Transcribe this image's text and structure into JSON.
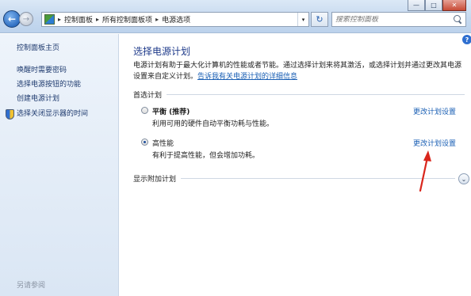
{
  "window": {
    "minimize_glyph": "—",
    "maximize_glyph": "□",
    "close_glyph": "✕"
  },
  "navigation": {
    "back_glyph": "←",
    "forward_glyph": "→",
    "dropdown_glyph": "▾",
    "breadcrumbs": [
      "控制面板",
      "所有控制面板项",
      "电源选项"
    ],
    "separator_glyph": "▸",
    "refresh_glyph": "↻",
    "search_placeholder": "搜索控制面板"
  },
  "sidebar": {
    "home_label": "控制面板主页",
    "items": [
      {
        "label": "唤醒时需要密码",
        "icon": ""
      },
      {
        "label": "选择电源按钮的功能",
        "icon": ""
      },
      {
        "label": "创建电源计划",
        "icon": ""
      },
      {
        "label": "选择关闭显示器的时间",
        "icon": "shield-icon"
      }
    ],
    "footer_label": "另请参阅"
  },
  "main": {
    "help_glyph": "?",
    "title": "选择电源计划",
    "intro_text": "电源计划有助于最大化计算机的性能或者节能。通过选择计划来将其激活，或选择计划并通过更改其电源设置来自定义计划。",
    "intro_link": "告诉我有关电源计划的详细信息",
    "preferred_section_label": "首选计划",
    "plans": [
      {
        "name": "平衡 (推荐)",
        "description": "利用可用的硬件自动平衡功耗与性能。",
        "selected": false,
        "change_link": "更改计划设置"
      },
      {
        "name": "高性能",
        "description": "有利于提高性能，但会增加功耗。",
        "selected": true,
        "change_link": "更改计划设置"
      }
    ],
    "additional_section_label": "显示附加计划",
    "expand_glyph": "⌄"
  },
  "colors": {
    "accent_link": "#1a5fb4",
    "title_blue": "#1e3a8a",
    "annotation_arrow": "#d9261c"
  }
}
